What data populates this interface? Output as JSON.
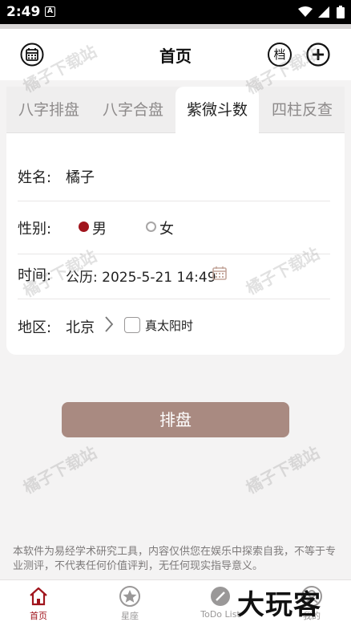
{
  "status_bar": {
    "time": "2:49",
    "notification_glyph": "A"
  },
  "header": {
    "title": "首页",
    "archive_label": "档",
    "left_icon": "calendar-icon",
    "right_icon": "plus-circle-icon"
  },
  "tabs": [
    {
      "label": "八字排盘",
      "active": false
    },
    {
      "label": "八字合盘",
      "active": false
    },
    {
      "label": "紫微斗数",
      "active": true
    },
    {
      "label": "四柱反查",
      "active": false
    }
  ],
  "form": {
    "name_label": "姓名:",
    "name_value": "橘子",
    "gender_label": "性别:",
    "gender_options": [
      {
        "label": "男",
        "selected": true
      },
      {
        "label": "女",
        "selected": false
      }
    ],
    "time_label": "时间:",
    "time_value": "公历: 2025-5-21 14:49",
    "region_label": "地区:",
    "region_value": "北京",
    "true_solar_time_label": "真太阳时",
    "true_solar_time_checked": false
  },
  "submit_label": "排盘",
  "disclaimer": "本软件为易经学术研究工具，内容仅供您在娱乐中探索自我，不等于专业测评，不代表任何价值评判，无任何现实指导意义。",
  "bottom_nav": [
    {
      "label": "首页",
      "icon": "home-icon",
      "active": true
    },
    {
      "label": "星座",
      "icon": "star-icon",
      "active": false
    },
    {
      "label": "ToDo List",
      "icon": "pencil-icon",
      "active": false
    },
    {
      "label": "我的",
      "icon": "user-icon",
      "active": false
    }
  ],
  "watermark": "橘子下载站",
  "brand_overlay": "大玩客",
  "colors": {
    "accent": "#a0141c",
    "button": "#a98a81",
    "background": "#f4f3f3"
  }
}
